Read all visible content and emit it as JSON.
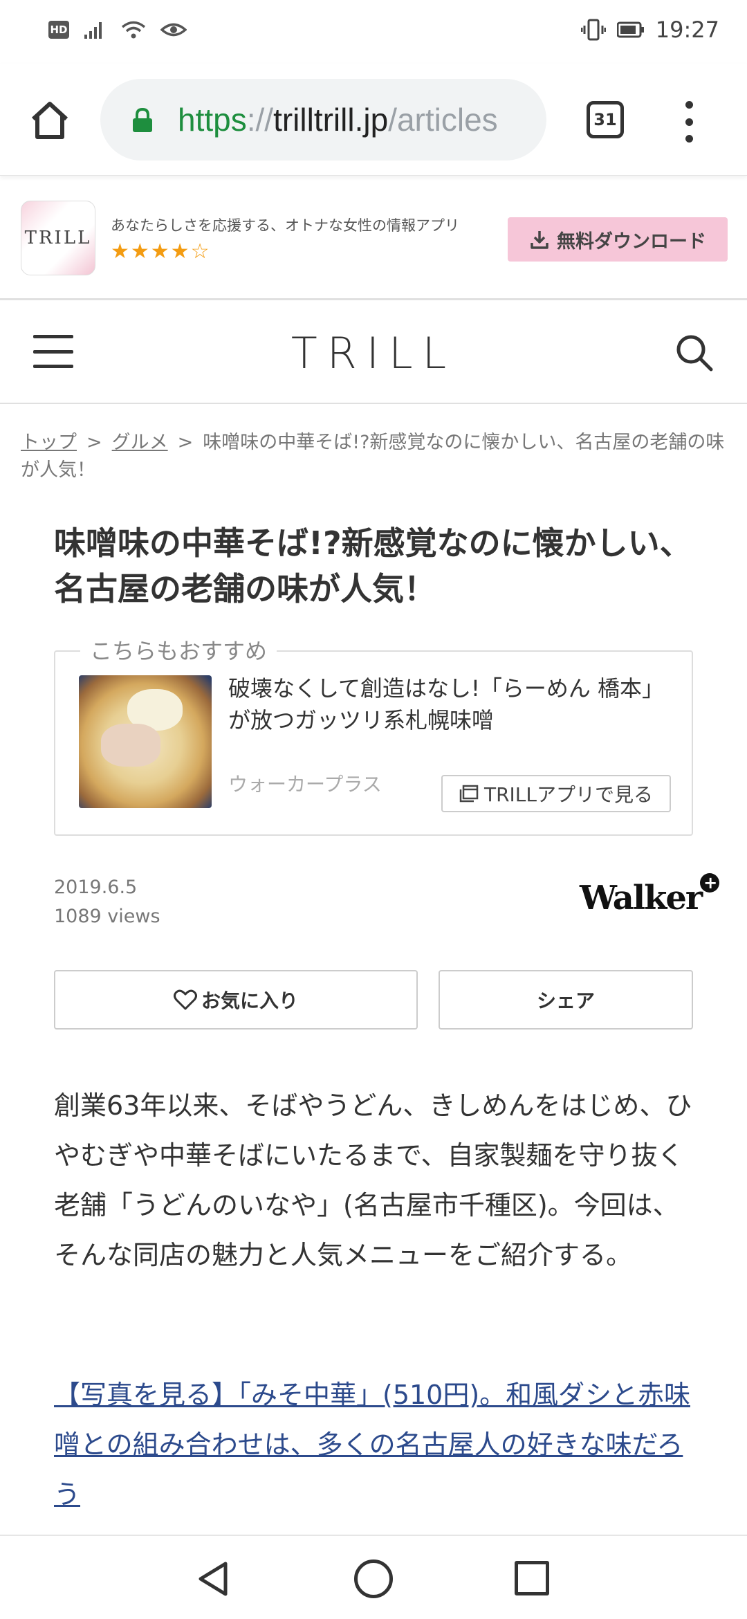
{
  "status_bar": {
    "hd_label": "HD",
    "time": "19:27",
    "icons": [
      "signal-icon",
      "wifi-icon",
      "eye-icon",
      "vibrate-icon",
      "battery-icon"
    ]
  },
  "browser": {
    "url_scheme": "https",
    "url_sep": "://",
    "url_host": "trilltrill.jp",
    "url_path": "/articles",
    "tab_count": "31",
    "colors": {
      "secure": "#1e8e3e",
      "url_muted": "#9aa0a6"
    }
  },
  "app_banner": {
    "icon_text": "TRILL",
    "tagline": "あなたらしさを応援する、オトナな女性の情報アプリ",
    "rating": 4.5,
    "rating_stars": "★★★★☆",
    "download_label": "無料ダウンロード",
    "colors": {
      "download_bg": "#f6c6d8",
      "stars": "#f39c12"
    }
  },
  "header": {
    "logo": "TRILL"
  },
  "breadcrumb": {
    "items": [
      "トップ",
      "グルメ"
    ],
    "separator": ">",
    "current": "味噌味の中華そば!?新感覚なのに懐かしい、名古屋の老舗の味が人気！"
  },
  "article": {
    "title": "味噌味の中華そば!?新感覚なのに懐かしい、名古屋の老舗の味が人気！",
    "date": "2019.6.5",
    "views": "1089 views",
    "publisher_logo": "Walker",
    "publisher_sub": "ウォーカープラス",
    "body": "創業63年以来、そばやうどん、きしめんをはじめ、ひやむぎや中華そばにいたるまで、自家製麺を守り抜く老舗「うどんのいなや」(名古屋市千種区)。今回は、そんな同店の魅力と人気メニューをご紹介する。",
    "photo_link": "【写真を見る】「みそ中華」(510円)。和風ダシと赤味噌との組み合わせは、多くの名古屋人の好きな味だろう"
  },
  "recommend": {
    "label": "こちらもおすすめ",
    "title": "破壊なくして創造はなし!「らーめん 橋本」が放つガッツリ系札幌味噌",
    "source": "ウォーカープラス",
    "app_button": "TRILLアプリで見る"
  },
  "actions": {
    "favorite": "お気に入り",
    "share": "シェア"
  }
}
